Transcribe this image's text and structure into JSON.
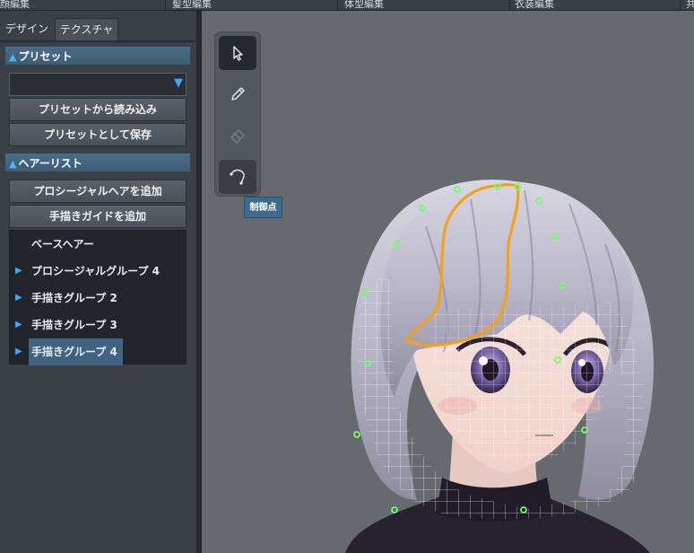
{
  "top_tabs": [
    "顔編集",
    "髪型編集",
    "体型編集",
    "衣装編集",
    "共"
  ],
  "panel_tabs": {
    "design": "デザイン",
    "texture": "テクスチャ"
  },
  "preset": {
    "header": "プリセット",
    "selected": "",
    "load_button": "プリセットから読み込み",
    "save_button": "プリセットとして保存"
  },
  "hair_list": {
    "header": "ヘアーリスト",
    "add_procedural_button": "プロシージャルヘアを追加",
    "add_guide_button": "手描きガイドを追加",
    "items": [
      {
        "label": "ベースヘアー",
        "expandable": false
      },
      {
        "label": "プロシージャルグループ 4",
        "expandable": true
      },
      {
        "label": "手描きグループ 2",
        "expandable": true
      },
      {
        "label": "手描きグループ 3",
        "expandable": true
      },
      {
        "label": "手描きグループ 4",
        "expandable": true,
        "selected": true
      }
    ]
  },
  "tools": [
    {
      "name": "select",
      "icon": "cursor-icon",
      "active": true
    },
    {
      "name": "draw",
      "icon": "pencil-icon",
      "active": false
    },
    {
      "name": "eraser",
      "icon": "eraser-icon",
      "active": false,
      "disabled": true
    },
    {
      "name": "control-point",
      "icon": "control-point-icon",
      "active": false,
      "hovered": true
    }
  ],
  "tooltip": "制御点",
  "colors": {
    "accent": "#3aa8ff",
    "section_header": "#46677f",
    "selection": "#3f6380",
    "guide_curve": "#f2a21a",
    "control_point": "#6dff6d"
  }
}
